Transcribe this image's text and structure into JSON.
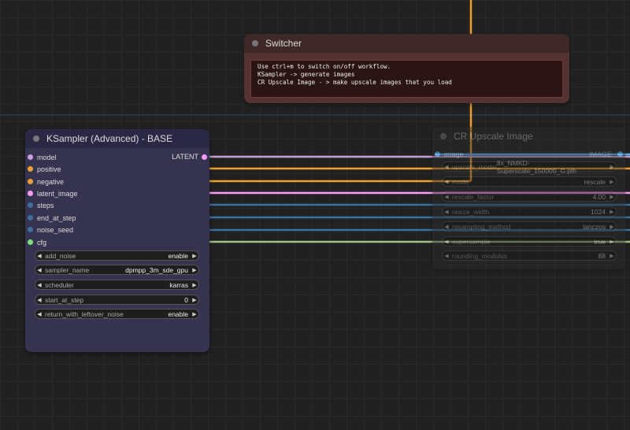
{
  "switcher": {
    "title": "Switcher",
    "note": "Use ctrl+m to switch on/off workflow.\nKSampler -> generate images\nCR Upscale Image - > make upscale images that you load"
  },
  "ksampler": {
    "title": "KSampler (Advanced) - BASE",
    "output_label": "LATENT",
    "inputs": [
      "model",
      "positive",
      "negative",
      "latent_image",
      "steps",
      "end_at_step",
      "noise_seed",
      "cfg"
    ],
    "widgets": [
      {
        "label": "add_noise",
        "value": "enable"
      },
      {
        "label": "sampler_name",
        "value": "dpmpp_3m_sde_gpu"
      },
      {
        "label": "scheduler",
        "value": "karras"
      },
      {
        "label": "start_at_step",
        "value": "0"
      },
      {
        "label": "return_with_leftover_noise",
        "value": "enable"
      }
    ]
  },
  "crupscale": {
    "title": "CR Upscale Image",
    "input_label": "image",
    "output_label": "IMAGE",
    "widgets": [
      {
        "label": "upscale_model",
        "value": "8x_NMKD-Superscale_150000_G.pth"
      },
      {
        "label": "mode",
        "value": "rescale"
      },
      {
        "label": "rescale_factor",
        "value": "4.00"
      },
      {
        "label": "resize_width",
        "value": "1024"
      },
      {
        "label": "resampling_method",
        "value": "lanczos"
      },
      {
        "label": "supersample",
        "value": "true"
      },
      {
        "label": "rounding_modulus",
        "value": "88"
      }
    ]
  },
  "colors": {
    "model": "#c8a0e0",
    "conditioning": "#f0a030",
    "latent": "#ff9cf9",
    "int": "#3c6fa0",
    "float": "#a0c080",
    "image": "#64b5f6"
  }
}
